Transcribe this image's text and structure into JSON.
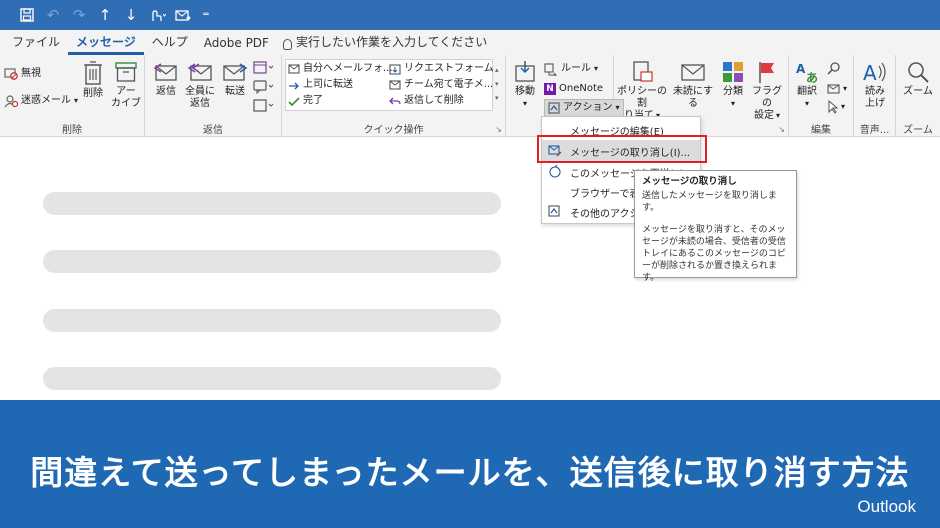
{
  "quick_access": {
    "icons": [
      "save-icon",
      "undo-icon",
      "redo-icon",
      "up-arrow-icon",
      "down-arrow-icon",
      "touch-mode-icon",
      "send-receive-icon",
      "customize-icon"
    ]
  },
  "menu_tabs": {
    "file": "ファイル",
    "message": "メッセージ",
    "help": "ヘルプ",
    "adobe": "Adobe PDF",
    "tell_me": "実行したい作業を入力してください"
  },
  "ribbon": {
    "delete_group": {
      "label": "削除",
      "ignore": "無視",
      "junk": "迷惑メール",
      "delete": "削除",
      "archive_1": "アー",
      "archive_2": "カイブ"
    },
    "reply_group": {
      "label": "返信",
      "reply": "返信",
      "reply_all_1": "全員に",
      "reply_all_2": "返信",
      "forward": "転送"
    },
    "quick_steps": {
      "label": "クイック操作",
      "items": [
        "自分へメールフォ...",
        "上司に転送",
        "完了",
        "リクエストフォーム",
        "チーム宛て電子メ...",
        "返信して削除"
      ]
    },
    "move_group": {
      "move": "移動",
      "rules": "ルール",
      "onenote": "OneNote",
      "actions": "アクション"
    },
    "tags_group": {
      "policy_1": "ポリシーの割",
      "policy_2": "り当て",
      "unread": "未読にする",
      "categorize": "分類",
      "flag_1": "フラグの",
      "flag_2": "設定"
    },
    "edit_group": {
      "label": "編集",
      "translate": "翻訳"
    },
    "voice_group": {
      "label": "音声...",
      "read_1": "読み",
      "read_2": "上げ"
    },
    "zoom_group": {
      "label": "ズーム",
      "zoom": "ズーム"
    }
  },
  "actions_menu": {
    "items": [
      "メッセージの編集(E)",
      "メッセージの取り消し(I)...",
      "このメッセージを再送(S)...",
      "ブラウザーで表示",
      "その他のアクション"
    ]
  },
  "tooltip": {
    "title": "メッセージの取り消し",
    "subtitle": "送信したメッセージを取り消します。",
    "body": "メッセージを取り消すと、そのメッセージが未読の場合、受信者の受信トレイにあるこのメッセージのコピーが削除されるか置き換えられます。"
  },
  "banner": {
    "title": "間違えて送ってしまったメールを、送信後に取り消す方法",
    "app": "Outlook"
  },
  "colors": {
    "titlebar": "#2f6db5",
    "banner": "#1f68b3",
    "accent": "#1f5ea8",
    "highlight_box": "#e02020"
  }
}
